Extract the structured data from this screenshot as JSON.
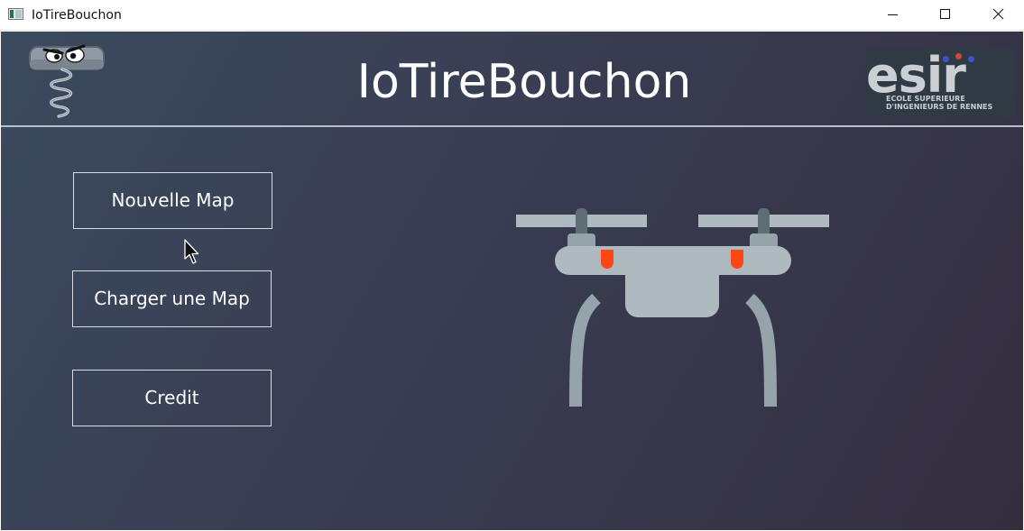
{
  "window": {
    "title": "IoTireBouchon",
    "controls": {
      "minimize_icon": "minimize-icon",
      "maximize_icon": "maximize-icon",
      "close_icon": "close-icon"
    }
  },
  "header": {
    "title": "IoTireBouchon",
    "mascot_icon": "corkscrew-mascot-icon",
    "logo": {
      "word": "esir",
      "subtitle": "ECOLE SUPERIEURE\nD'INGENIEURS DE RENNES",
      "dot_colors": [
        "#3b55c8",
        "#d64535",
        "#3b55c8"
      ]
    }
  },
  "menu": {
    "new_map": "Nouvelle Map",
    "load_map": "Charger une Map",
    "credit": "Credit"
  },
  "illustration": {
    "icon": "drone-icon"
  },
  "colors": {
    "background_start": "#3b4a5e",
    "background_end": "#352e40",
    "button_border": "#d9dde3",
    "text": "#ffffff",
    "drone_body": "#aeb9c0",
    "drone_accent": "#ff4514"
  }
}
